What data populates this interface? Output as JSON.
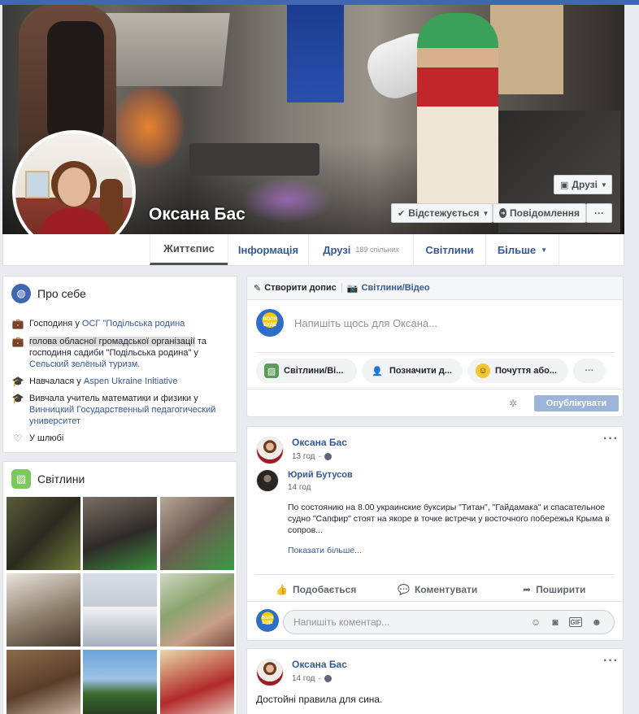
{
  "profile": {
    "name": "Оксана Бас",
    "friends_button": "Друзі",
    "following_button": "Відстежується",
    "message_button": "Повідомлення",
    "more_button": "···"
  },
  "tabs": [
    {
      "label": "Життєпис"
    },
    {
      "label": "Інформація"
    },
    {
      "label": "Друзі",
      "sub": "189 спільних"
    },
    {
      "label": "Світлини"
    },
    {
      "label": "Більше"
    }
  ],
  "about": {
    "title": "Про себе",
    "work1_prefix": "Господиня у ",
    "work1_link": "ОСГ \"Подільська родина",
    "work2_highlight": "голова обласної громадської організації",
    "work2_rest": " та господиня садиби \"Подільська родина\" у",
    "work2_link": "Сельский зелёный туризм.",
    "edu1_prefix": "Навчалася у ",
    "edu1_link": "Aspen Ukraine Initiative",
    "edu2_prefix": "Вивчала учитель математики и физики у",
    "edu2_link": "Винницкий Государственный педагогический университет",
    "relationship": "У шлюбі"
  },
  "photos": {
    "title": "Світлини"
  },
  "composer": {
    "create_post": "Створити допис",
    "photo_video_tab": "Світлини/Відео",
    "placeholder": "Напишіть щось для Оксана...",
    "photo_pill": "Світлини/Ві...",
    "tag_pill": "Позначити д...",
    "feeling_pill": "Почуття або...",
    "more_pill": "···",
    "publish": "Опублікувати",
    "avatar_text": "ВОЛЯ БУДЕ"
  },
  "post1": {
    "author": "Оксана Бас",
    "time": "13 год",
    "shared_author": "Юрий Бутусов",
    "shared_time": "14 год",
    "text": "По состоянию на 8.00 украинские буксиры \"Титан\", \"Гайдамака\" и спасательное судно \"Сапфир\" стоят на якоре в точке встречи у восточного побережья Крыма в сопров...",
    "show_more": "Показати більше...",
    "like": "Подобається",
    "comment": "Коментувати",
    "share": "Поширити",
    "comment_placeholder": "Напишіть коментар..."
  },
  "post2": {
    "author": "Оксана Бас",
    "time": "14 год",
    "text": "Достойні правила для сина."
  }
}
